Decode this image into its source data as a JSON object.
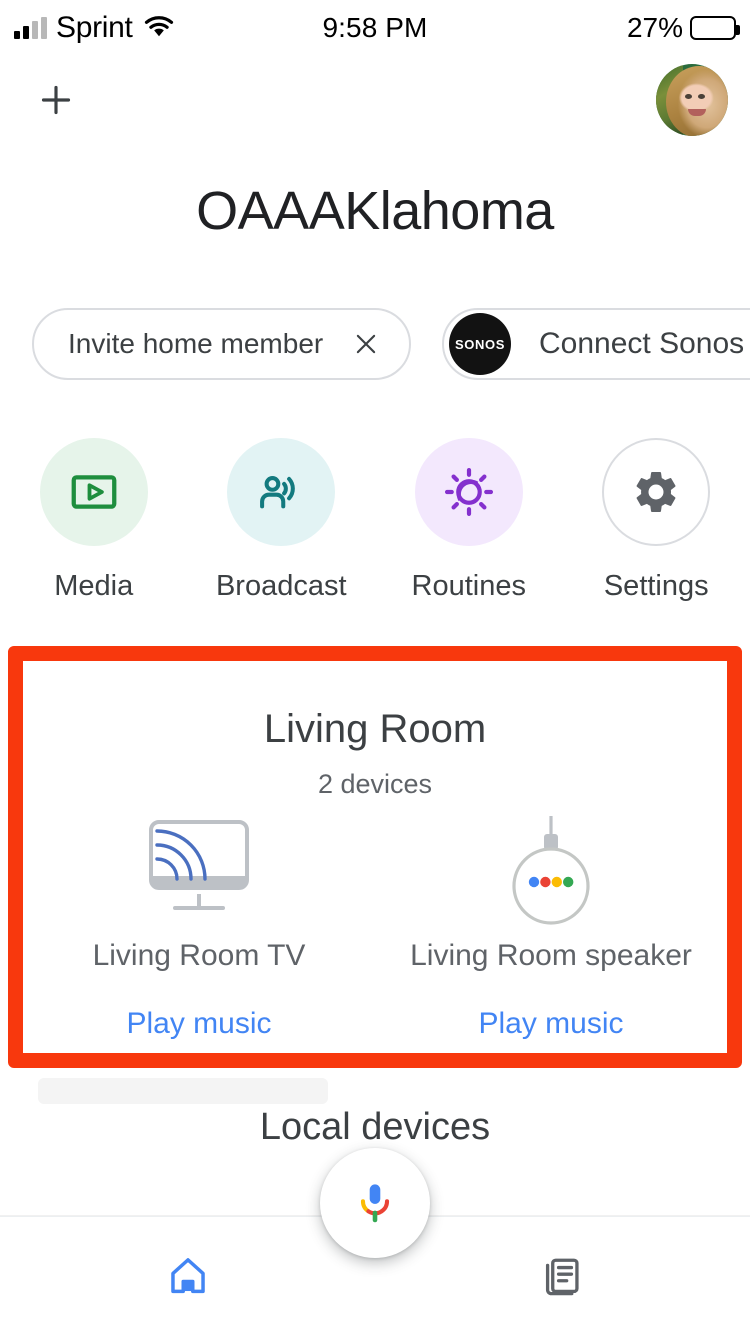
{
  "status_bar": {
    "carrier": "Sprint",
    "time": "9:58 PM",
    "battery_percent": "27%",
    "signal_icon": "cellular-bars-icon",
    "wifi_icon": "wifi-icon",
    "battery_icon": "battery-icon"
  },
  "header": {
    "add_icon": "plus-icon",
    "avatar_name": "account-avatar",
    "home_title": "OAAAKlahoma"
  },
  "chips": [
    {
      "label": "Invite home member",
      "close_icon": "close-icon",
      "name": "invite-home-member-chip"
    },
    {
      "label": "Connect Sonos",
      "badge_text": "SONOS",
      "name": "connect-sonos-chip"
    }
  ],
  "quick_actions": [
    {
      "label": "Media",
      "icon": "media-play-icon",
      "bubble_color": "#e6f4ea",
      "icon_color": "#1e8e3e"
    },
    {
      "label": "Broadcast",
      "icon": "broadcast-icon",
      "bubble_color": "#e2f3f4",
      "icon_color": "#137a7f"
    },
    {
      "label": "Routines",
      "icon": "routines-sun-icon",
      "bubble_color": "#f3e8fd",
      "icon_color": "#8430ce"
    },
    {
      "label": "Settings",
      "icon": "gear-icon",
      "bubble_color": "#ffffff",
      "icon_color": "#5f6368"
    }
  ],
  "highlight": {
    "border_color": "#f8380d"
  },
  "room_card": {
    "title": "Living Room",
    "subtitle": "2 devices",
    "devices": [
      {
        "name": "Living Room TV",
        "action": "Play music",
        "icon": "chromecast-tv-icon"
      },
      {
        "name": "Living Room speaker",
        "action": "Play music",
        "icon": "google-home-speaker-icon"
      }
    ]
  },
  "local_section": {
    "title": "Local devices"
  },
  "assistant": {
    "fab_icon": "google-assistant-mic-icon"
  },
  "bottom_nav": [
    {
      "icon": "home-icon",
      "name": "nav-home",
      "active": true,
      "color": "#4285f4"
    },
    {
      "icon": "feed-icon",
      "name": "nav-feed",
      "active": false,
      "color": "#5f6368"
    }
  ],
  "brand_colors": {
    "blue": "#4285f4",
    "red": "#ea4335",
    "yellow": "#fbbc04",
    "green": "#34a853",
    "link_blue": "#4285f4",
    "annotation_red": "#f8380d"
  }
}
